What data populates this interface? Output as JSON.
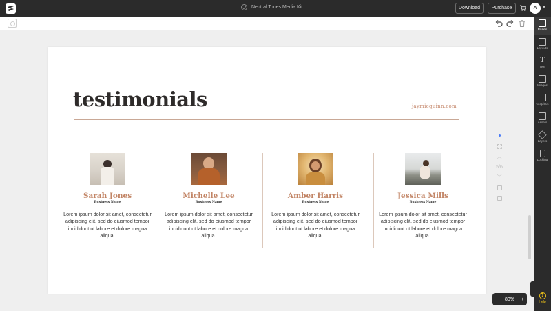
{
  "topbar": {
    "title": "Neutral Tones Media Kit",
    "download": "Download",
    "purchase": "Purchase",
    "avatar_initial": "A"
  },
  "sidebar": {
    "items": [
      {
        "label": "Basics",
        "icon": "basics-icon"
      },
      {
        "label": "Layouts",
        "icon": "layouts-icon"
      },
      {
        "label": "Text",
        "icon": "text-icon"
      },
      {
        "label": "Images",
        "icon": "images-icon"
      },
      {
        "label": "Graphics",
        "icon": "graphics-icon"
      },
      {
        "label": "Assets",
        "icon": "assets-icon"
      },
      {
        "label": "Layers",
        "icon": "layers-icon"
      },
      {
        "label": "Locking",
        "icon": "locking-icon"
      }
    ],
    "help": "Help"
  },
  "page": {
    "heading": "testimonials",
    "site": "jaymiequinn.com",
    "cards": [
      {
        "name": "Sarah Jones",
        "role": "Business Name",
        "body": "Lorem ipsum dolor sit amet, consectetur adipiscing elit, sed do eiusmod tempor incididunt ut labore et dolore magna aliqua."
      },
      {
        "name": "Michelle Lee",
        "role": "Business Name",
        "body": "Lorem ipsum dolor sit amet, consectetur adipiscing elit, sed do eiusmod tempor incididunt ut labore et dolore magna aliqua."
      },
      {
        "name": "Amber Harris",
        "role": "Business Name",
        "body": "Lorem ipsum dolor sit amet, consectetur adipiscing elit, sed do eiusmod tempor incididunt ut labore et dolore magna aliqua."
      },
      {
        "name": "Jessica Mills",
        "role": "Business Name",
        "body": "Lorem ipsum dolor sit amet, consectetur adipiscing elit, sed do eiusmod tempor incididunt ut labore et dolore magna aliqua."
      }
    ]
  },
  "page_controls": {
    "counter": "5/6"
  },
  "zoom": {
    "minus": "−",
    "level": "80%",
    "plus": "+"
  },
  "colors": {
    "accent": "#c28566",
    "dark": "#2b2b2b",
    "highlight_dot": "#4a7cf7",
    "help": "#f0c419"
  }
}
